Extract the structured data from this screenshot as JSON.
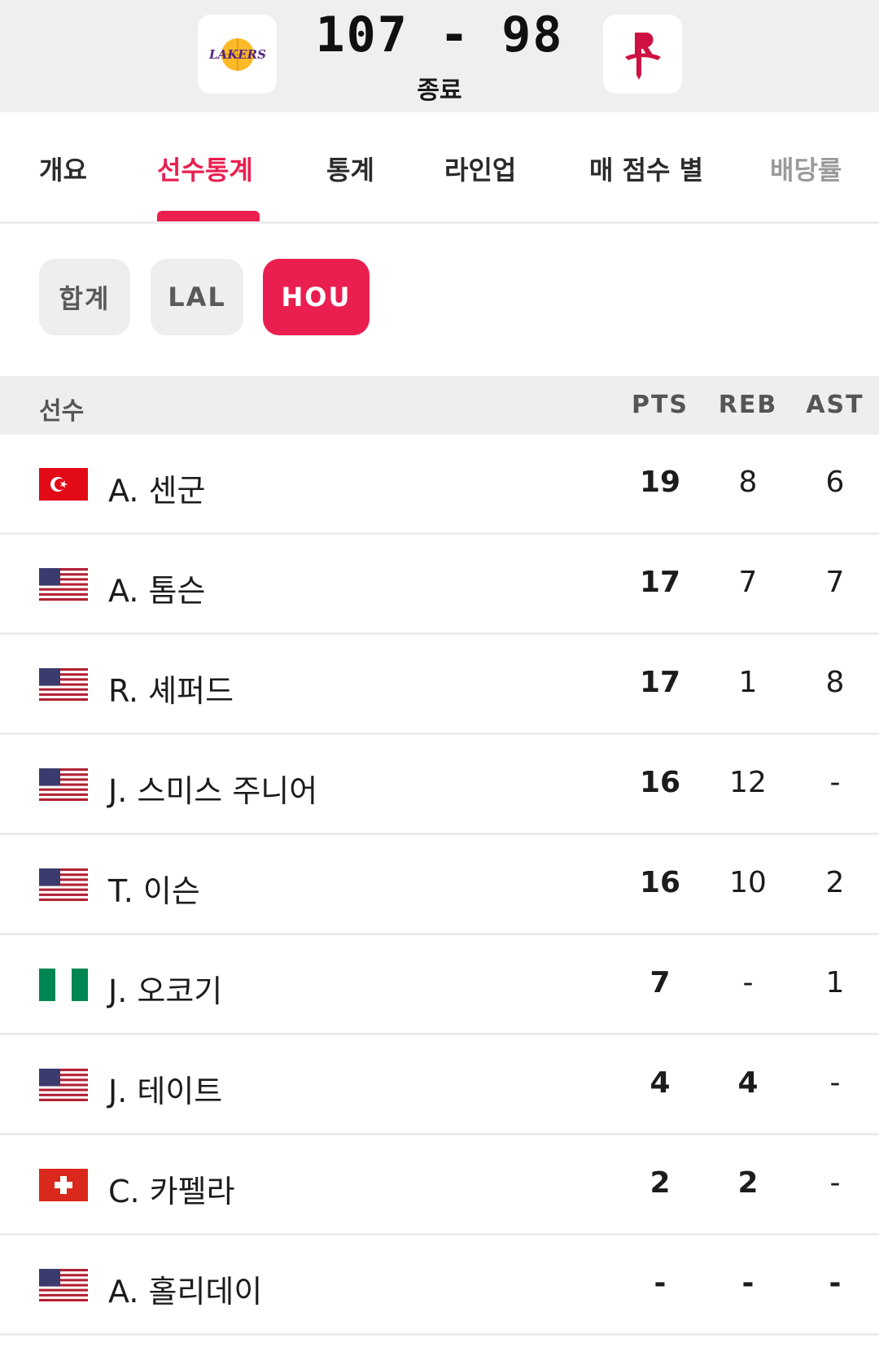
{
  "header": {
    "home_team": "LAL",
    "away_team": "HOU",
    "home_logo_text": "LAKERS",
    "score": "107 - 98",
    "status": "종료",
    "colors": {
      "lakers_purple": "#552583",
      "lakers_gold": "#FDB927",
      "rockets_red": "#CE1141"
    }
  },
  "tabs": [
    {
      "label": "개요"
    },
    {
      "label": "선수통계",
      "active": true
    },
    {
      "label": "통계"
    },
    {
      "label": "라인업"
    },
    {
      "label": "매 점수 별"
    },
    {
      "label": "배당률"
    }
  ],
  "filters": [
    {
      "label": "합계"
    },
    {
      "label": "LAL"
    },
    {
      "label": "HOU",
      "active": true
    }
  ],
  "table": {
    "headers": {
      "player": "선수",
      "pts": "PTS",
      "reb": "REB",
      "ast": "AST"
    },
    "rows": [
      {
        "flag": "turkey-flag-icon",
        "name": "A. 센군",
        "pts": "19",
        "reb": "8",
        "ast": "6"
      },
      {
        "flag": "usa-flag-icon",
        "name": "A. 톰슨",
        "pts": "17",
        "reb": "7",
        "ast": "7"
      },
      {
        "flag": "usa-flag-icon",
        "name": "R. 셰퍼드",
        "pts": "17",
        "reb": "1",
        "ast": "8"
      },
      {
        "flag": "usa-flag-icon",
        "name": "J. 스미스 주니어",
        "pts": "16",
        "reb": "12",
        "ast": "-"
      },
      {
        "flag": "usa-flag-icon",
        "name": "T. 이슨",
        "pts": "16",
        "reb": "10",
        "ast": "2"
      },
      {
        "flag": "nigeria-flag-icon",
        "name": "J. 오코기",
        "pts": "7",
        "reb": "-",
        "ast": "1"
      },
      {
        "flag": "usa-flag-icon",
        "name": "J. 테이트",
        "pts": "4",
        "reb": "4",
        "ast": "-"
      },
      {
        "flag": "switzerland-flag-icon",
        "name": "C. 카펠라",
        "pts": "2",
        "reb": "2",
        "ast": "-"
      },
      {
        "flag": "usa-flag-icon",
        "name": "A. 홀리데이",
        "pts": "-",
        "reb": "-",
        "ast": "-"
      }
    ]
  },
  "accent_color": "#EA1F4F"
}
